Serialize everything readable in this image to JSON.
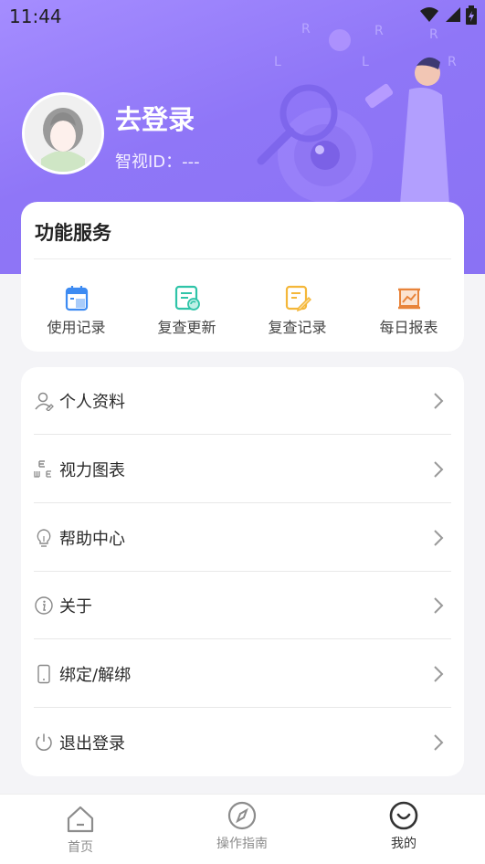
{
  "status_bar": {
    "time": "11:44"
  },
  "profile": {
    "name": "去登录",
    "id_text": "智视ID：---"
  },
  "services": {
    "title": "功能服务",
    "items": [
      {
        "label": "使用记录",
        "icon": "clipboard-icon",
        "color": "#3d8bf2"
      },
      {
        "label": "复查更新",
        "icon": "refresh-document-icon",
        "color": "#2fc4a8"
      },
      {
        "label": "复查记录",
        "icon": "edit-document-icon",
        "color": "#f4b73a"
      },
      {
        "label": "每日报表",
        "icon": "chart-board-icon",
        "color": "#e8843a"
      }
    ]
  },
  "menu": {
    "items": [
      {
        "label": "个人资料",
        "icon": "user-icon"
      },
      {
        "label": "视力图表",
        "icon": "eye-chart-icon"
      },
      {
        "label": "帮助中心",
        "icon": "lightbulb-icon"
      },
      {
        "label": "关于",
        "icon": "info-icon"
      },
      {
        "label": "绑定/解绑",
        "icon": "phone-icon"
      },
      {
        "label": "退出登录",
        "icon": "power-icon"
      }
    ]
  },
  "tabbar": {
    "items": [
      {
        "label": "首页",
        "icon": "home-icon",
        "active": false
      },
      {
        "label": "操作指南",
        "icon": "compass-icon",
        "active": false
      },
      {
        "label": "我的",
        "icon": "smile-icon",
        "active": true
      }
    ]
  },
  "colors": {
    "accent": "#8f76f7",
    "background": "#f4f4f7"
  }
}
